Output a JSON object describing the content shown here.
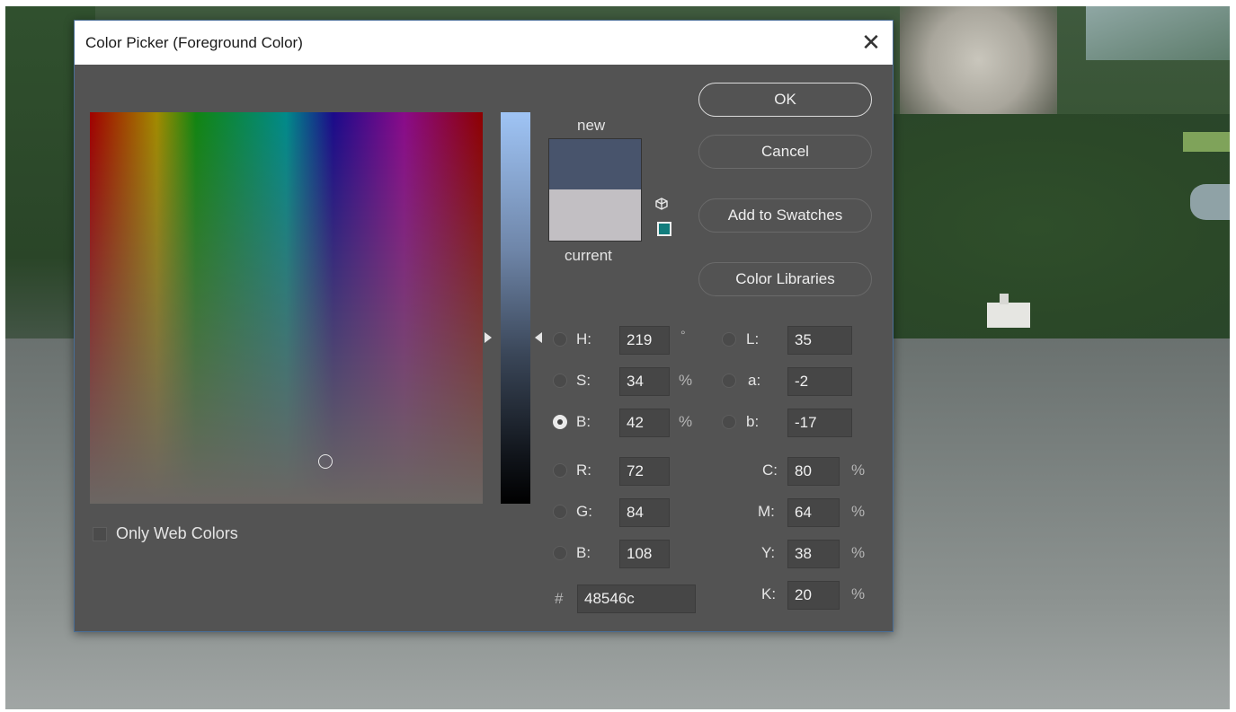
{
  "dialog": {
    "title": "Color Picker (Foreground Color)",
    "close_glyph": "✕"
  },
  "preview": {
    "new_label": "new",
    "current_label": "current",
    "new_color": "#48546c",
    "current_color": "#c2bfc3"
  },
  "buttons": {
    "ok": "OK",
    "cancel": "Cancel",
    "add_to_swatches": "Add to Swatches",
    "color_libraries": "Color Libraries"
  },
  "hsb": {
    "h_label": "H:",
    "h_value": "219",
    "h_unit": "°",
    "s_label": "S:",
    "s_value": "34",
    "s_unit": "%",
    "b_label": "B:",
    "b_value": "42",
    "b_unit": "%",
    "selected": "B"
  },
  "rgb": {
    "r_label": "R:",
    "r_value": "72",
    "g_label": "G:",
    "g_value": "84",
    "b_label": "B:",
    "b_value": "108"
  },
  "lab": {
    "l_label": "L:",
    "l_value": "35",
    "a_label": "a:",
    "a_value": "-2",
    "b_label": "b:",
    "b_value": "-17"
  },
  "cmyk": {
    "c_label": "C:",
    "c_value": "80",
    "m_label": "M:",
    "m_value": "64",
    "y_label": "Y:",
    "y_value": "38",
    "k_label": "K:",
    "k_value": "20",
    "unit": "%"
  },
  "hex": {
    "label": "#",
    "value": "48546c"
  },
  "options": {
    "only_web_colors": "Only Web Colors",
    "only_web_colors_checked": false
  },
  "icons": {
    "cube": "cube-icon",
    "websafe": "web-safe-swatch-icon",
    "close": "close-icon"
  }
}
